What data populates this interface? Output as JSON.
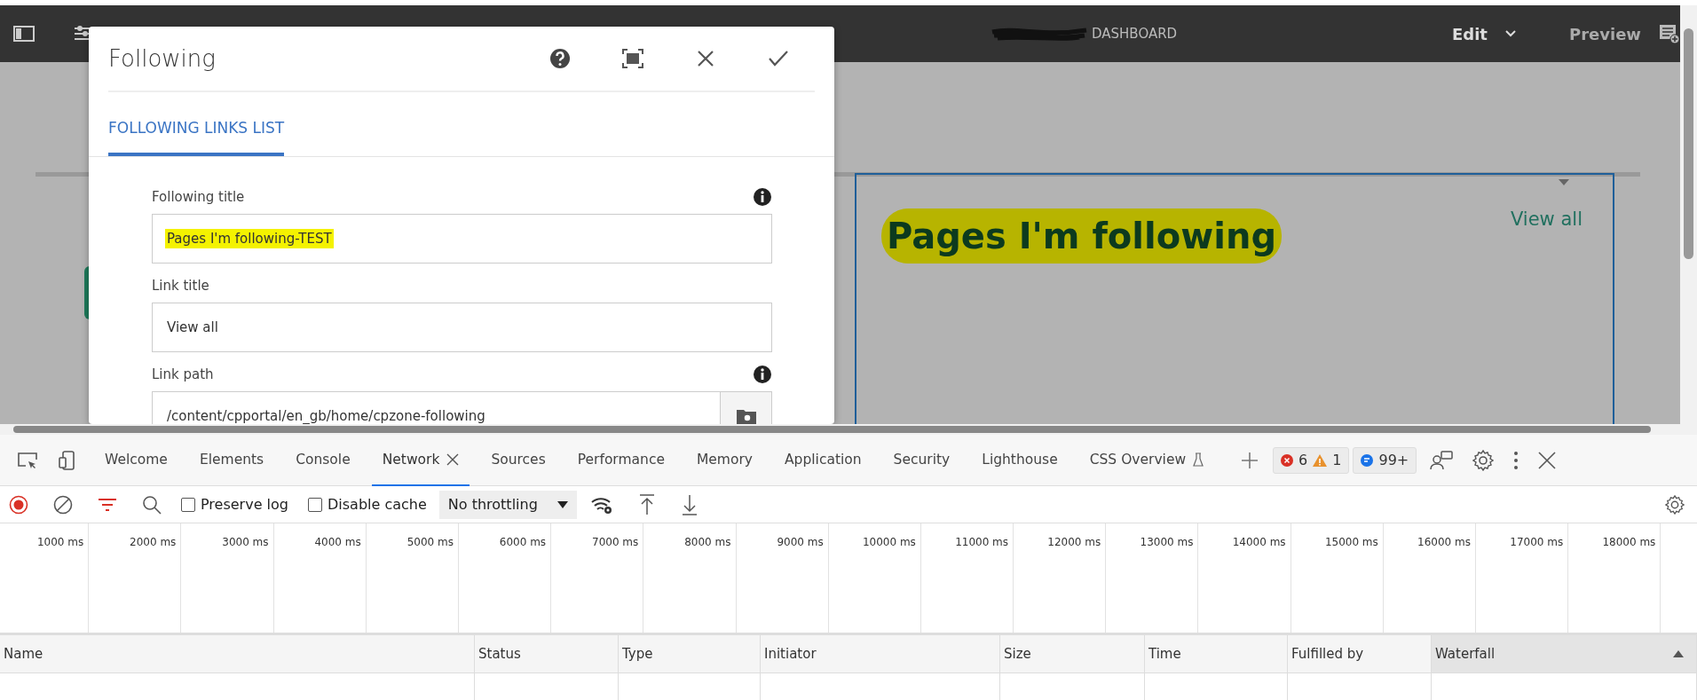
{
  "top_bar": {
    "title": "DASHBOARD",
    "mode": "Edit",
    "preview": "Preview"
  },
  "dialog": {
    "title": "Following",
    "tabs": [
      {
        "label": "FOLLOWING LINKS LIST",
        "selected": true
      }
    ],
    "fields": [
      {
        "label": "Following title",
        "value": "Pages I'm following-TEST",
        "info": true,
        "highlighted": true,
        "browse": false
      },
      {
        "label": "Link title",
        "value": "View all",
        "info": false,
        "highlighted": false,
        "browse": false
      },
      {
        "label": "Link path",
        "value": "/content/cpportal/en_gb/home/cpzone-following",
        "info": true,
        "highlighted": false,
        "browse": true
      }
    ]
  },
  "page_panel": {
    "heading": "Pages I'm following",
    "heading_highlighted": true,
    "link": "View all"
  },
  "devtools": {
    "tabs": [
      {
        "label": "Welcome",
        "selected": false,
        "closable": false,
        "experimental": false
      },
      {
        "label": "Elements",
        "selected": false,
        "closable": false,
        "experimental": false
      },
      {
        "label": "Console",
        "selected": false,
        "closable": false,
        "experimental": false
      },
      {
        "label": "Network",
        "selected": true,
        "closable": true,
        "experimental": false
      },
      {
        "label": "Sources",
        "selected": false,
        "closable": false,
        "experimental": false
      },
      {
        "label": "Performance",
        "selected": false,
        "closable": false,
        "experimental": false
      },
      {
        "label": "Memory",
        "selected": false,
        "closable": false,
        "experimental": false
      },
      {
        "label": "Application",
        "selected": false,
        "closable": false,
        "experimental": false
      },
      {
        "label": "Security",
        "selected": false,
        "closable": false,
        "experimental": false
      },
      {
        "label": "Lighthouse",
        "selected": false,
        "closable": false,
        "experimental": false
      },
      {
        "label": "CSS Overview",
        "selected": false,
        "closable": false,
        "experimental": true
      }
    ],
    "errors": "6",
    "warnings": "1",
    "messages": "99+",
    "toolbar": {
      "recording": true,
      "preserve_log": false,
      "preserve_log_label": "Preserve log",
      "disable_cache": false,
      "disable_cache_label": "Disable cache",
      "throttling": "No throttling"
    },
    "timeline_ticks": [
      "1000 ms",
      "2000 ms",
      "3000 ms",
      "4000 ms",
      "5000 ms",
      "6000 ms",
      "7000 ms",
      "8000 ms",
      "9000 ms",
      "10000 ms",
      "11000 ms",
      "12000 ms",
      "13000 ms",
      "14000 ms",
      "15000 ms",
      "16000 ms",
      "17000 ms",
      "18000 ms"
    ],
    "columns": [
      {
        "label": "Name",
        "sorted": false
      },
      {
        "label": "Status",
        "sorted": false
      },
      {
        "label": "Type",
        "sorted": false
      },
      {
        "label": "Initiator",
        "sorted": false
      },
      {
        "label": "Size",
        "sorted": false
      },
      {
        "label": "Time",
        "sorted": false
      },
      {
        "label": "Fulfilled by",
        "sorted": false
      },
      {
        "label": "Waterfall",
        "sorted": true
      }
    ]
  }
}
